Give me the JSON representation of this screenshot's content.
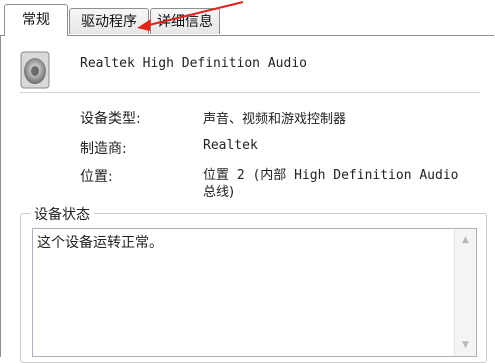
{
  "tabs": [
    {
      "label": "常规",
      "active": true
    },
    {
      "label": "驱动程序",
      "active": false
    },
    {
      "label": "详细信息",
      "active": false
    }
  ],
  "device": {
    "icon": "speaker-icon",
    "name": "Realtek High Definition Audio"
  },
  "properties": {
    "type_label": "设备类型:",
    "type_value": "声音、视频和游戏控制器",
    "manufacturer_label": "制造商:",
    "manufacturer_value": "Realtek",
    "location_label": "位置:",
    "location_value_line1": "位置 2 (内部 High Definition Audio",
    "location_value_line2": "总线)"
  },
  "status": {
    "group_title": "设备状态",
    "text": "这个设备运转正常。"
  },
  "annotation": {
    "color": "#e0241c"
  }
}
